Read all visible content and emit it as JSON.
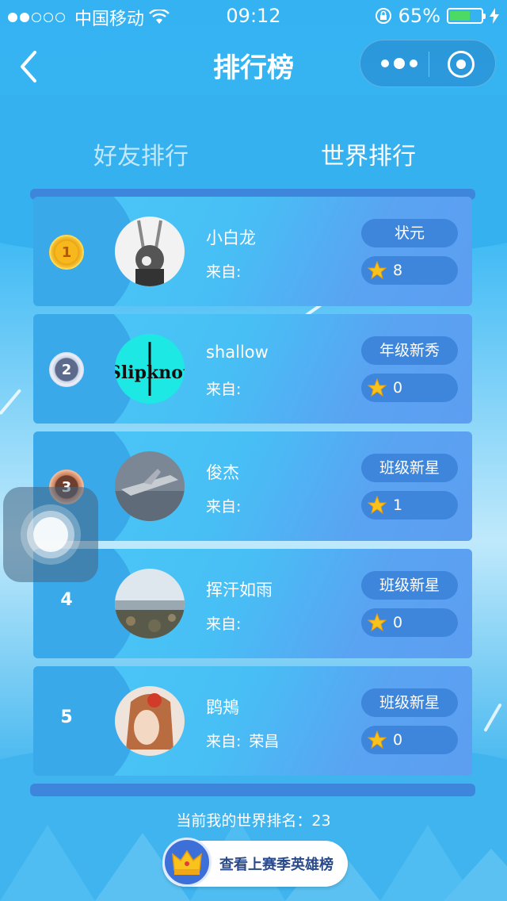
{
  "status_bar": {
    "carrier": "中国移动",
    "time": "09:12",
    "battery": "65%"
  },
  "nav": {
    "title": "排行榜"
  },
  "tabs": [
    {
      "label": "好友排行",
      "active": false
    },
    {
      "label": "世界排行",
      "active": true
    }
  ],
  "from_label": "来自:",
  "ranking": [
    {
      "rank": "1",
      "name": "小白龙",
      "title": "状元",
      "stars": "8",
      "location": ""
    },
    {
      "rank": "2",
      "name": "shallow",
      "title": "年级新秀",
      "stars": "0",
      "location": ""
    },
    {
      "rank": "3",
      "name": "俊杰",
      "title": "班级新星",
      "stars": "1",
      "location": ""
    },
    {
      "rank": "4",
      "name": "挥汗如雨",
      "title": "班级新星",
      "stars": "0",
      "location": ""
    },
    {
      "rank": "5",
      "name": "鹍鴂",
      "title": "班级新星",
      "stars": "0",
      "location": "荣昌"
    }
  ],
  "my_rank_text": "当前我的世界排名：23",
  "hero_button_label": "查看上赛季英雄榜",
  "colors": {
    "background": "#3ab4ef",
    "badge": "#3d86db",
    "battery_fill": "#4cd964"
  }
}
